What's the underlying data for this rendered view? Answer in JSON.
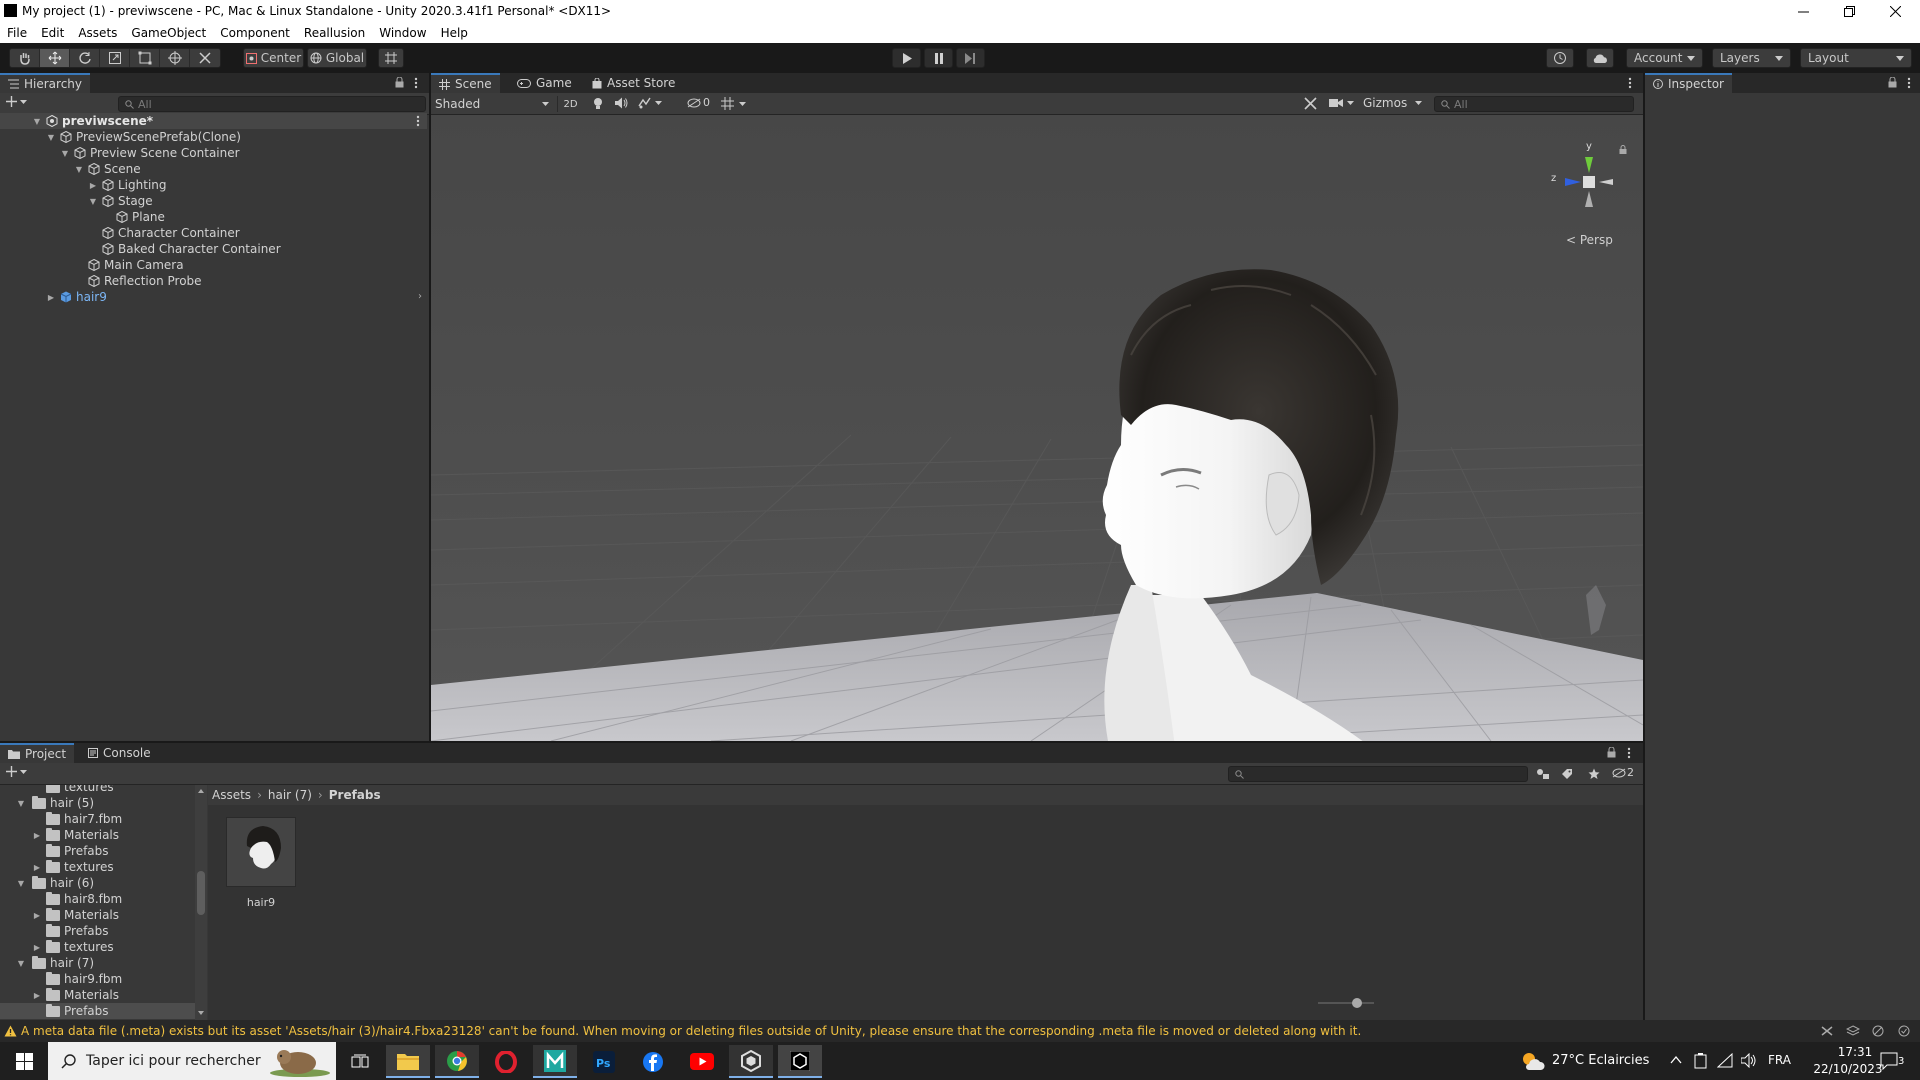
{
  "window": {
    "title": "My project (1) - previwscene - PC, Mac & Linux Standalone - Unity 2020.3.41f1 Personal* <DX11>"
  },
  "menu": [
    "File",
    "Edit",
    "Assets",
    "GameObject",
    "Component",
    "Reallusion",
    "Window",
    "Help"
  ],
  "toolbar": {
    "pivot": "Center",
    "space": "Global",
    "account": "Account",
    "layers": "Layers",
    "layout": "Layout"
  },
  "hierarchy": {
    "tab": "Hierarchy",
    "search_placeholder": "All",
    "rows": [
      {
        "label": "previwscene*",
        "bold": true
      },
      {
        "label": "PreviewScenePrefab(Clone)"
      },
      {
        "label": "Preview Scene Container"
      },
      {
        "label": "Scene"
      },
      {
        "label": "Lighting"
      },
      {
        "label": "Stage"
      },
      {
        "label": "Plane"
      },
      {
        "label": "Character Container"
      },
      {
        "label": "Baked Character Container"
      },
      {
        "label": "Main Camera"
      },
      {
        "label": "Reflection Probe"
      },
      {
        "label": "hair9",
        "prefab": true
      }
    ]
  },
  "scene": {
    "tabs": [
      "Scene",
      "Game",
      "Asset Store"
    ],
    "shading": "Shaded",
    "mode_2d": "2D",
    "hidden_count": "0",
    "gizmos": "Gizmos",
    "search_placeholder": "All",
    "axis_y": "y",
    "axis_z": "z",
    "projection": "< Persp"
  },
  "inspector": {
    "tab": "Inspector"
  },
  "project": {
    "tabs": [
      "Project",
      "Console"
    ],
    "tree": [
      {
        "label": "textures",
        "depth": 2
      },
      {
        "label": "hair (5)",
        "depth": 1,
        "open": true
      },
      {
        "label": "hair7.fbm",
        "depth": 2
      },
      {
        "label": "Materials",
        "depth": 2,
        "arrow": true
      },
      {
        "label": "Prefabs",
        "depth": 2
      },
      {
        "label": "textures",
        "depth": 2,
        "arrow": true
      },
      {
        "label": "hair (6)",
        "depth": 1,
        "open": true
      },
      {
        "label": "hair8.fbm",
        "depth": 2
      },
      {
        "label": "Materials",
        "depth": 2,
        "arrow": true
      },
      {
        "label": "Prefabs",
        "depth": 2
      },
      {
        "label": "textures",
        "depth": 2,
        "arrow": true
      },
      {
        "label": "hair (7)",
        "depth": 1,
        "open": true
      },
      {
        "label": "hair9.fbm",
        "depth": 2
      },
      {
        "label": "Materials",
        "depth": 2,
        "arrow": true
      },
      {
        "label": "Prefabs",
        "depth": 2,
        "selected": true
      }
    ],
    "breadcrumb": [
      "Assets",
      "hair (7)",
      "Prefabs"
    ],
    "assets": [
      {
        "label": "hair9"
      }
    ],
    "hidden_packages": "2"
  },
  "console_message": "A meta data file (.meta) exists but its asset 'Assets/hair (3)/hair4.Fbxa23128' can't be found. When moving or deleting files outside of Unity, please ensure that the corresponding .meta file is moved or deleted along with it.",
  "taskbar": {
    "search_placeholder": "Taper ici pour rechercher",
    "weather": "27°C  Eclaircies",
    "language": "FRA",
    "time": "17:31",
    "date": "22/10/2023",
    "notifications": "3"
  },
  "colors": {
    "accent": "#3a79bb",
    "prefab": "#7cb6f5",
    "warning": "#f0c040",
    "panel": "#383838"
  }
}
